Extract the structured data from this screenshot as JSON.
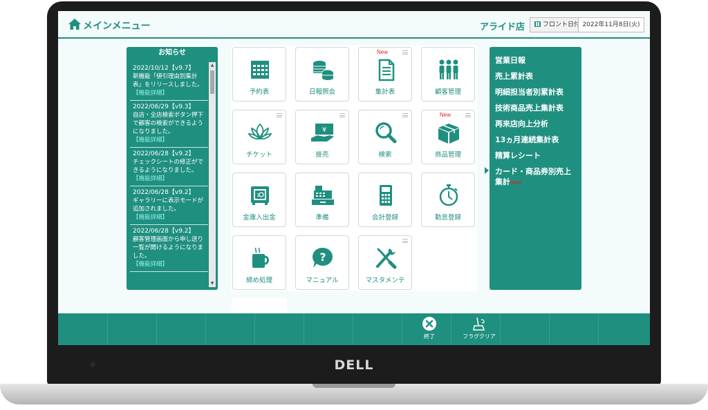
{
  "header": {
    "title": "メインメニュー",
    "store": "アライド店",
    "date_label": "フロント日付",
    "date_value": "2022年11月8日(火)"
  },
  "news": {
    "title": "お知らせ",
    "items": [
      {
        "date": "2022/10/12【v9.7】",
        "text": "新機能「値引理由別集計表」をリリースしました。",
        "link": "【機能詳細】"
      },
      {
        "date": "2022/06/29【v9.3】",
        "text": "自店・全店検索ボタン押下で顧客の検索ができるようになりました。",
        "link": "【機能詳細】"
      },
      {
        "date": "2022/06/28【v9.2】",
        "text": "チェックシートの修正ができるようになりました。",
        "link": "【機能詳細】"
      },
      {
        "date": "2022/06/28【v9.2】",
        "text": "ギャラリーに表示モードが追加されました。",
        "link": "【機能詳細】"
      },
      {
        "date": "2022/06/28【v9.2】",
        "text": "顧客管理画面から申し送り一覧が開けるようになりました。",
        "link": "【機能詳細】"
      }
    ]
  },
  "tiles": {
    "reservations": "予約表",
    "daily_report": "日報照会",
    "summary": "集計表",
    "customer_mgmt": "顧客管理",
    "ticket": "チケット",
    "credit_sales": "掛売",
    "search": "検索",
    "product_mgmt": "商品管理",
    "safe_cash": "金庫入出金",
    "preparation": "準備",
    "accounting": "会計登録",
    "attendance": "勤怠登録",
    "closing": "締め処理",
    "manual": "マニュアル",
    "master_maintenance": "マスタメンテ",
    "new_badge": "New"
  },
  "reports": {
    "items": [
      "営業日報",
      "売上累計表",
      "明細担当者別累計表",
      "技術商品売上集計表",
      "再来店向上分析",
      "13ヵ月連続集計表",
      "精算レシート",
      "カード・商品券別売上集計"
    ],
    "new_badge": "New"
  },
  "footer": {
    "exit_label": "終了",
    "flag_clear_label": "フラグクリア"
  },
  "device": {
    "brand": "DELL"
  },
  "colors": {
    "accent": "#1f8f80",
    "new_badge": "#e0201a"
  }
}
